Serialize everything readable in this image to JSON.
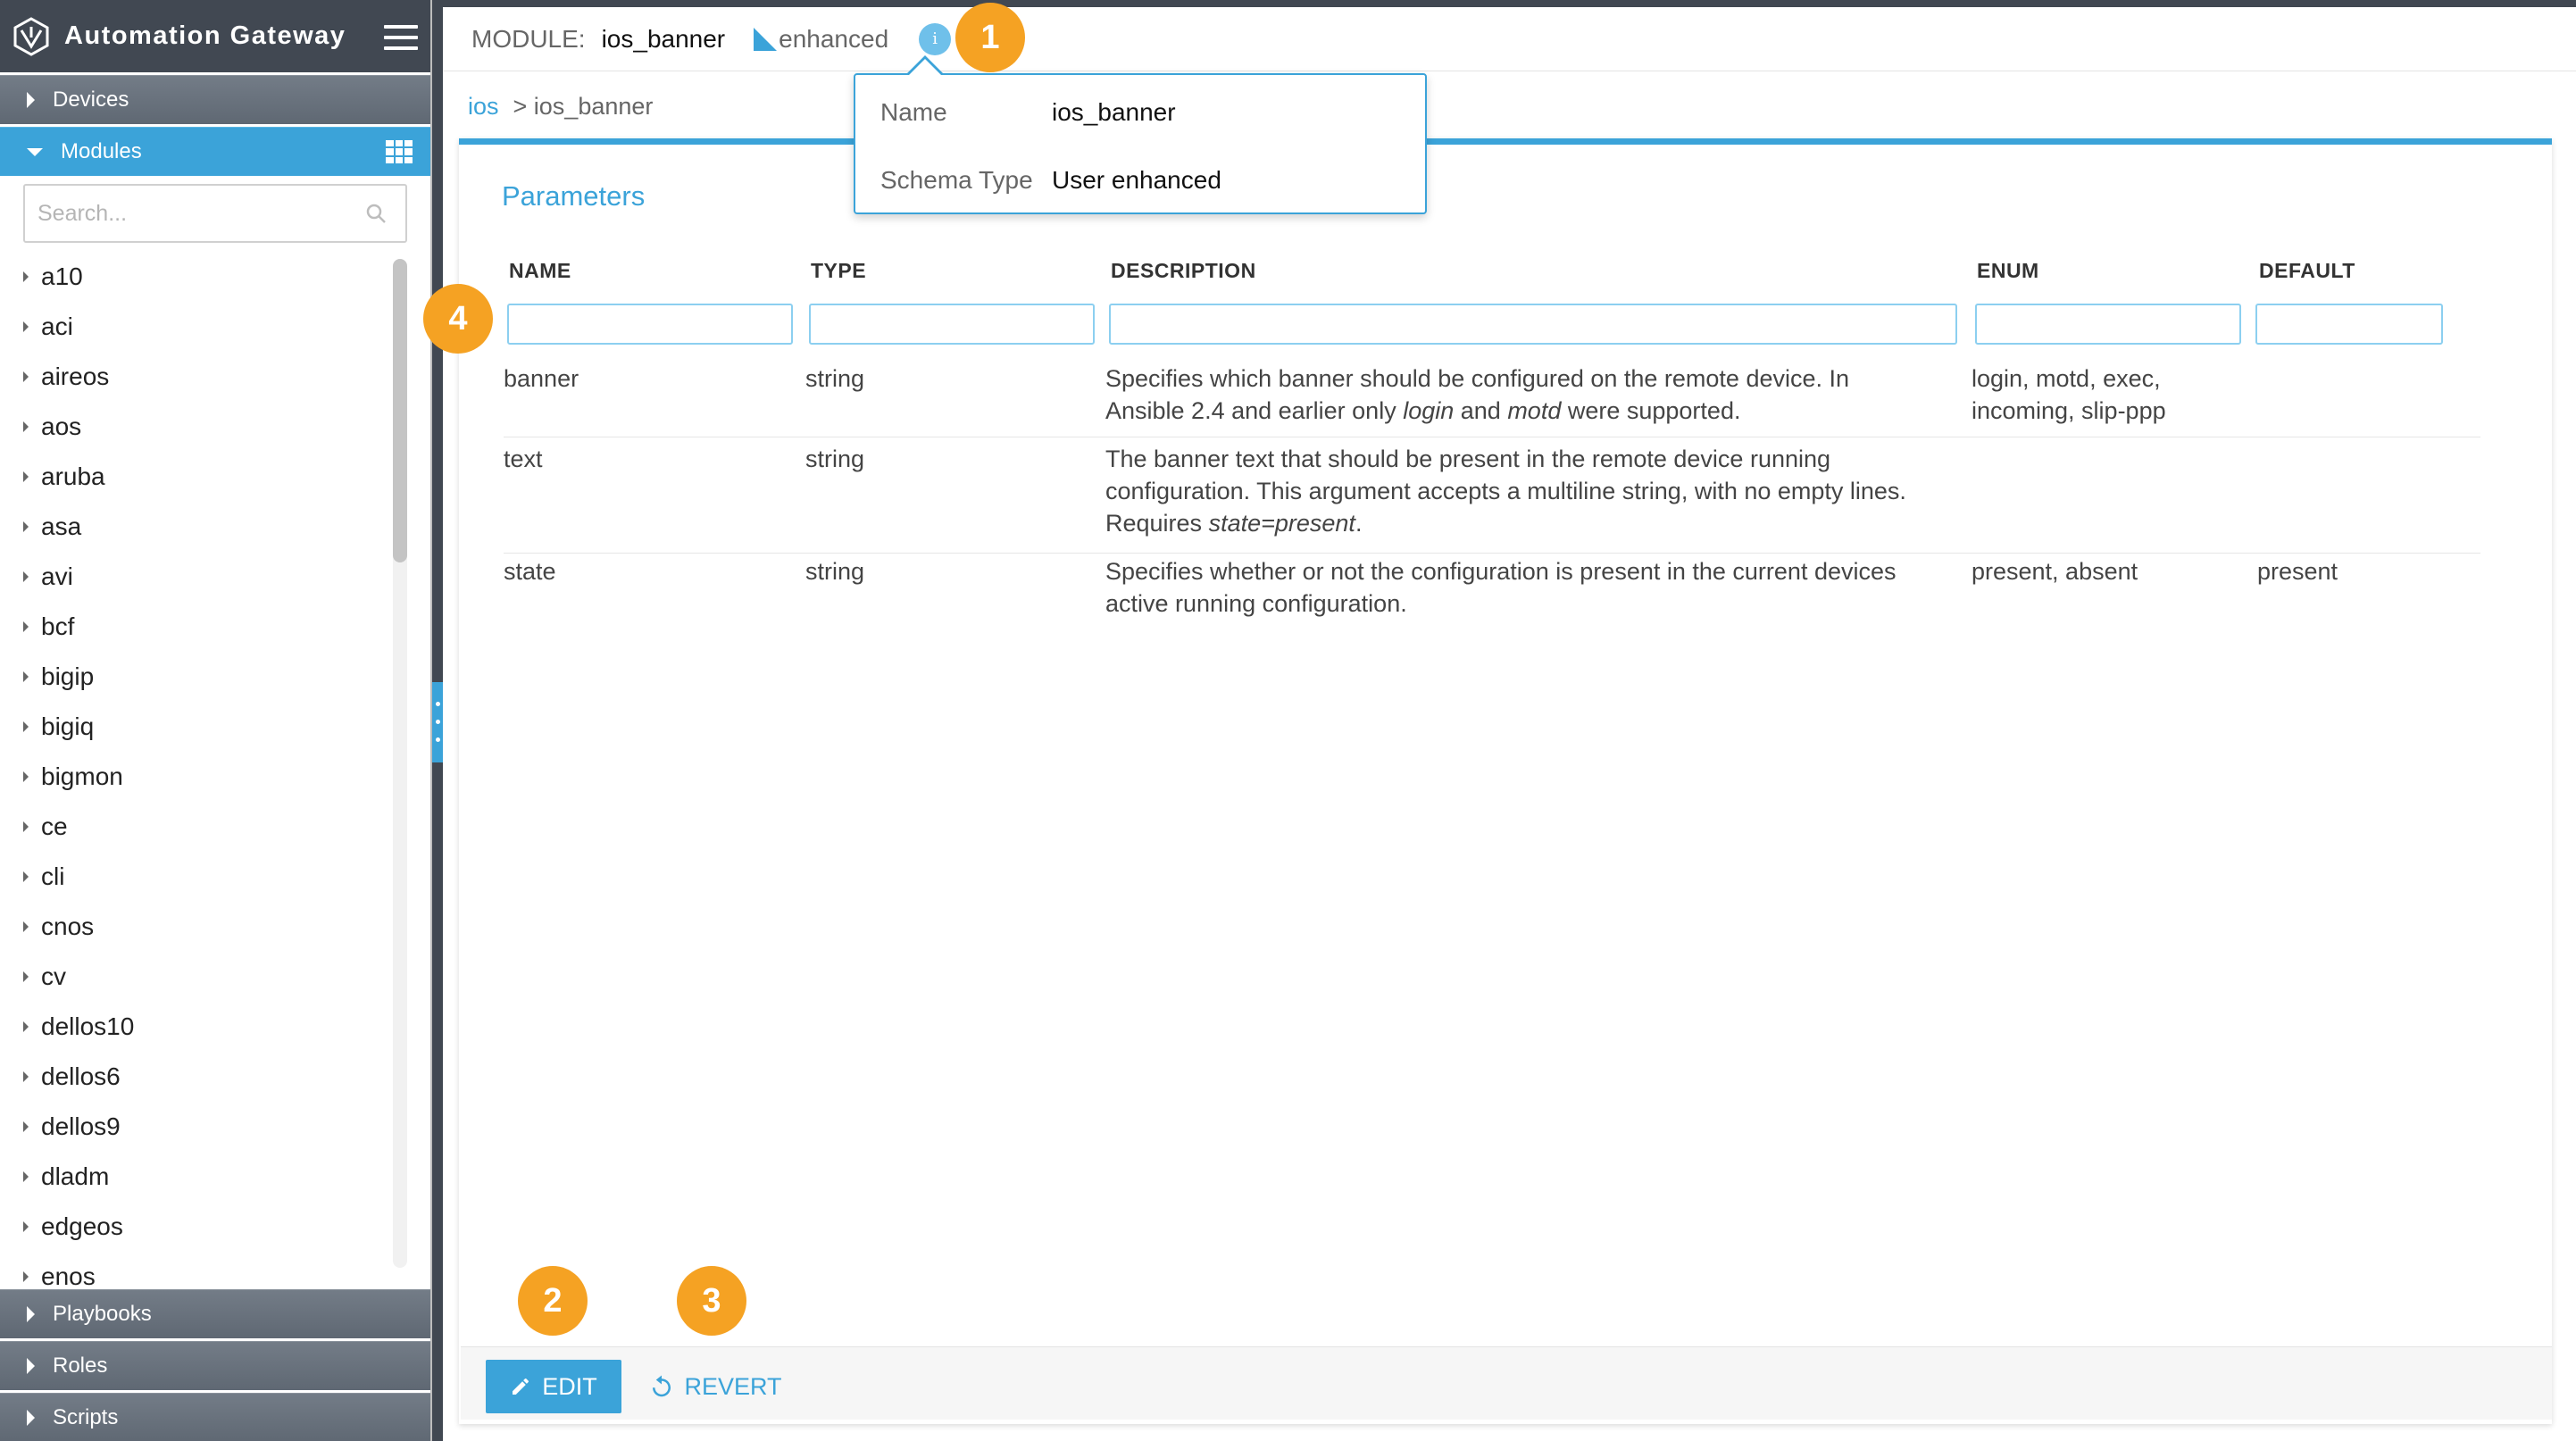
{
  "app": {
    "title": "Automation Gateway"
  },
  "sidebar": {
    "sections": {
      "devices": "Devices",
      "modules": "Modules",
      "playbooks": "Playbooks",
      "roles": "Roles",
      "scripts": "Scripts"
    },
    "search": {
      "placeholder": "Search...",
      "value": ""
    },
    "modules": [
      "a10",
      "aci",
      "aireos",
      "aos",
      "aruba",
      "asa",
      "avi",
      "bcf",
      "bigip",
      "bigiq",
      "bigmon",
      "ce",
      "cli",
      "cnos",
      "cv",
      "dellos10",
      "dellos6",
      "dellos9",
      "dladm",
      "edgeos",
      "enos"
    ]
  },
  "header": {
    "module_label": "MODULE:",
    "module_name": "ios_banner",
    "enhanced_label": "enhanced",
    "info_glyph": "i"
  },
  "breadcrumb": {
    "parent": "ios",
    "current": "> ios_banner"
  },
  "popover": {
    "name_label": "Name",
    "name_value": "ios_banner",
    "schema_label": "Schema Type",
    "schema_value": "User enhanced"
  },
  "parameters": {
    "title": "Parameters",
    "columns": {
      "name": "NAME",
      "type": "TYPE",
      "description": "DESCRIPTION",
      "enum": "ENUM",
      "default": "DEFAULT"
    },
    "rows": [
      {
        "name": "banner",
        "type": "string",
        "description": {
          "l1": "Specifies which banner should be configured on the remote device. In",
          "l2a": "Ansible 2.4 and earlier only ",
          "l2b": "login",
          "l2c": " and ",
          "l2d": "motd",
          "l2e": " were supported."
        },
        "enum": {
          "l1": "login, motd, exec,",
          "l2": "incoming, slip-ppp"
        },
        "default": ""
      },
      {
        "name": "text",
        "type": "string",
        "description": {
          "l1": "The banner text that should be present in the remote device running",
          "l2": "configuration. This argument accepts a multiline string, with no empty lines.",
          "l3a": "Requires ",
          "l3b": "state=present",
          "l3c": "."
        },
        "enum": "",
        "default": ""
      },
      {
        "name": "state",
        "type": "string",
        "description": {
          "l1": "Specifies whether or not the configuration is present in the current devices",
          "l2": "active running configuration."
        },
        "enum": "present, absent",
        "default": "present"
      }
    ]
  },
  "actions": {
    "edit": "EDIT",
    "revert": "REVERT"
  },
  "callouts": {
    "c1": "1",
    "c2": "2",
    "c3": "3",
    "c4": "4"
  },
  "colors": {
    "accent": "#3ba3d9",
    "sidebar_dark": "#414852",
    "callout": "#f5a223"
  }
}
